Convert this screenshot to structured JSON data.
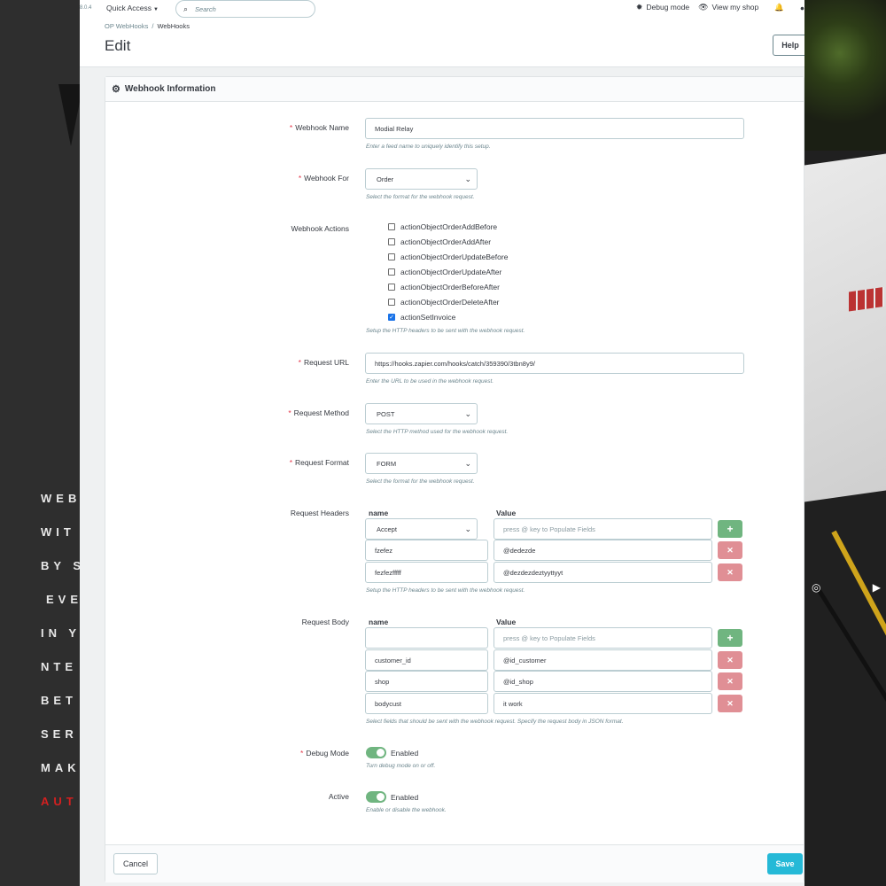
{
  "background": {
    "words": [
      "WEB",
      "WIT",
      "BY S",
      "EVE",
      "IN Y",
      "NTE",
      "BET",
      "SER",
      "MAK",
      "AUT"
    ]
  },
  "topbar": {
    "version": "8.0.4",
    "quick_access": "Quick Access",
    "search_placeholder": "Search",
    "debug_mode": "Debug mode",
    "view_shop": "View my shop"
  },
  "header": {
    "breadcrumb": [
      "OP WebHooks",
      "WebHooks"
    ],
    "title": "Edit",
    "help": "Help"
  },
  "card": {
    "title": "Webhook Information"
  },
  "form": {
    "webhook_name": {
      "label": "Webhook Name",
      "value": "Modial Relay",
      "help": "Enter a feed name to uniquely identify this setup."
    },
    "webhook_for": {
      "label": "Webhook For",
      "value": "Order",
      "help": "Select the format for the webhook request."
    },
    "webhook_actions": {
      "label": "Webhook Actions",
      "items": [
        {
          "label": "actionObjectOrderAddBefore",
          "checked": false
        },
        {
          "label": "actionObjectOrderAddAfter",
          "checked": false
        },
        {
          "label": "actionObjectOrderUpdateBefore",
          "checked": false
        },
        {
          "label": "actionObjectOrderUpdateAfter",
          "checked": false
        },
        {
          "label": "actionObjectOrderBeforeAfter",
          "checked": false
        },
        {
          "label": "actionObjectOrderDeleteAfter",
          "checked": false
        },
        {
          "label": "actionSetInvoice",
          "checked": true
        }
      ],
      "help": "Setup the HTTP headers to be sent with the webhook request."
    },
    "request_url": {
      "label": "Request URL",
      "value": "https://hooks.zapier.com/hooks/catch/359390/3tbn8y9/",
      "help": "Enter the URL to be used in the webhook request."
    },
    "request_method": {
      "label": "Request Method",
      "value": "POST",
      "help": "Select the HTTP method used for the webhook request."
    },
    "request_format": {
      "label": "Request Format",
      "value": "FORM",
      "help": "Select the format for the webhook request."
    },
    "request_headers": {
      "label": "Request Headers",
      "col_name": "name",
      "col_value": "Value",
      "rows": [
        {
          "name": "Accept",
          "value": "press @ key to Populate Fields",
          "name_is_select": true,
          "value_is_placeholder": true
        },
        {
          "name": "fzefez",
          "value": "@dedezde"
        },
        {
          "name": "fezfezfffff",
          "value": "@dezdezdeztyyttyyt"
        }
      ],
      "help": "Setup the HTTP headers to be sent with the webhook request."
    },
    "request_body": {
      "label": "Request Body",
      "col_name": "name",
      "col_value": "Value",
      "rows": [
        {
          "name": "",
          "value": "press @ key to Populate Fields",
          "value_is_placeholder": true
        },
        {
          "name": "customer_id",
          "value": "@id_customer"
        },
        {
          "name": "shop",
          "value": "@id_shop"
        },
        {
          "name": "bodycust",
          "value": "it work"
        }
      ],
      "help": "Select fields that should be sent with the webhook request. Specify the request body in JSON format."
    },
    "debug_mode": {
      "label": "Debug Mode",
      "state": "Enabled",
      "help": "Turn debug mode on or off."
    },
    "active": {
      "label": "Active",
      "state": "Enabled",
      "help": "Enable or disable the webhook."
    }
  },
  "footer": {
    "cancel": "Cancel",
    "save": "Save"
  },
  "colors": {
    "accent": "#25b9d7",
    "add": "#70b580",
    "delete": "#e08f95",
    "required": "#e3374a"
  }
}
